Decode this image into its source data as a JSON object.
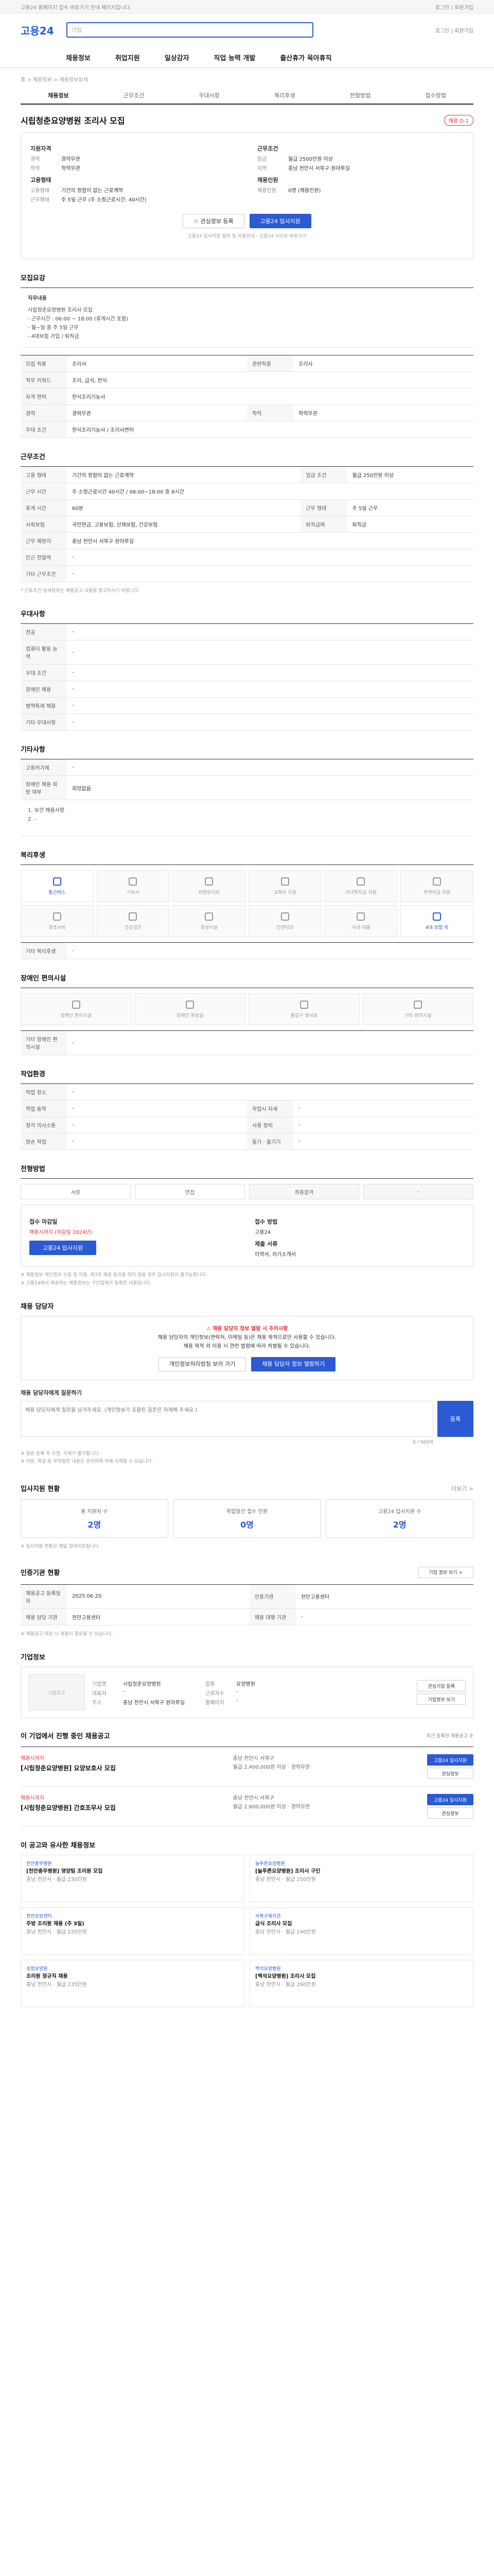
{
  "topbar": {
    "left": "고용24 홈페이지 접속 바로가기 안내 페이지입니다.",
    "right": "로그인 | 회원가입"
  },
  "header": {
    "logo": "고용24",
    "search_placeholder": "기업",
    "right": "로그인 | 회원가입"
  },
  "gnb": [
    "채용정보",
    "취업지원",
    "일상감자",
    "직업 능력 개발",
    "출산휴가 육아휴직"
  ],
  "breadcrumb": "홈 > 채용정보 > 채용정보상세",
  "subtabs": [
    "채용정보",
    "근무조건",
    "우대사항",
    "복리후생",
    "전형방법",
    "접수방법"
  ],
  "posting": {
    "title": "시립청춘요양병원 조리사 모집",
    "badge": "채용 D-1",
    "summary_left_label": "지원자격",
    "summary_left": [
      {
        "k": "경력",
        "v": "경력무관"
      },
      {
        "k": "학력",
        "v": "학력무관"
      }
    ],
    "summary_left_label2": "고용형태",
    "summary_left2": [
      {
        "k": "고용형태",
        "v": "기간의 정함이 없는 근로계약"
      },
      {
        "k": "근무형태",
        "v": "주 5일 근무 (주 소정근로시간: 40시간)"
      }
    ],
    "summary_right_label": "근무조건",
    "summary_right": [
      {
        "k": "임금",
        "v": "월급 2500만원 이상"
      },
      {
        "k": "지역",
        "v": "충남 천안시 서북구 원마루길"
      }
    ],
    "summary_right_label2": "채용인원",
    "summary_right2": [
      {
        "k": "채용인원",
        "v": "0명 (채용인원)"
      }
    ],
    "scrap_label": "관심정보 등록",
    "apply_label": "고용24 입사지원",
    "note": "고용24 입사지원 절차 및 이용안내 - 고용24 사이트 바로가기"
  },
  "recruit": {
    "title": "모집요강",
    "desc_title": "직무내용",
    "desc_lines": [
      "시립청춘요양병원 조리사 모집",
      "- 근무시간 : 06:00 ~ 18:00 (휴게시간 포함)",
      "- 월~일 중 주 5일 근무",
      "- 4대보험 가입 / 퇴직금"
    ],
    "rows": [
      {
        "k": "모집 직종",
        "v": "조리사",
        "k2": "관련직종",
        "v2": "조리사"
      },
      {
        "k": "직무 키워드",
        "v": "조리, 급식, 한식"
      },
      {
        "k": "자격 면허",
        "v": "한식조리기능사"
      },
      {
        "k": "경력",
        "v": "경력무관",
        "k2": "학력",
        "v2": "학력무관"
      },
      {
        "k": "우대 조건",
        "v": "한식조리기능사 / 조리사면허"
      }
    ]
  },
  "work": {
    "title": "근무조건",
    "rows": [
      {
        "k": "고용 형태",
        "v": "기간의 정함이 없는 근로계약",
        "k2": "임금 조건",
        "v2": "월급 250만원 이상"
      },
      {
        "k": "근무 시간",
        "v": "주 소정근로시간 40시간 / 06:00~18:00 중 8시간"
      },
      {
        "k": "휴게 시간",
        "v": "60분",
        "k2": "근무 형태",
        "v2": "주 5일 근무"
      },
      {
        "k": "사회보험",
        "v": "국민연금, 고용보험, 산재보험, 건강보험",
        "k2": "퇴직급여",
        "v2": "퇴직금"
      },
      {
        "k": "근무 예정지",
        "v": "충남 천안시 서북구 원마루길"
      },
      {
        "k": "인근 전철역",
        "v": "-"
      },
      {
        "k": "기타 근무조건",
        "v": "-"
      }
    ],
    "note": "* 근로조건 상세정보는 채용공고 내용을 참고하시기 바랍니다."
  },
  "prefer": {
    "title": "우대사항",
    "rows": [
      {
        "k": "전공",
        "v": "-"
      },
      {
        "k": "컴퓨터 활용 능력",
        "v": "-"
      },
      {
        "k": "우대 조건",
        "v": "-"
      },
      {
        "k": "장애인 채용",
        "v": "-"
      },
      {
        "k": "병역특례 채용",
        "v": "-"
      },
      {
        "k": "기타 우대사항",
        "v": "-"
      }
    ]
  },
  "other": {
    "title": "기타사항",
    "rows": [
      {
        "k": "고용허가제",
        "v": "-"
      },
      {
        "k": "장애인 채용 희망 여부",
        "v": "희망없음"
      }
    ],
    "desc": "1. 보건 채용사항\n2. -"
  },
  "welfare": {
    "title": "복리후생",
    "items": [
      "통근버스",
      "기숙사",
      "차량유지비",
      "교육비 지원",
      "자녀학자금 지원",
      "주택자금 지원",
      "경조사비",
      "건강검진",
      "휴양시설",
      "인센티브",
      "사내 대출",
      "4대 보험 외"
    ],
    "etc_label": "기타 복리후생",
    "etc_value": "-"
  },
  "disabled": {
    "title": "장애인 편의시설",
    "items": [
      "장애인 편의시설",
      "장애인 화장실",
      "출입구 경사로",
      "기타 편의시설"
    ],
    "etc_label": "기타 장애인 편의시설",
    "etc_value": "-"
  },
  "worksite": {
    "title": "작업환경",
    "rows": [
      {
        "k": "작업 장소",
        "v": "-"
      },
      {
        "k": "작업 동작",
        "v": "-",
        "k2": "작업시 자세",
        "v2": "-"
      },
      {
        "k": "청각 의사소통",
        "v": "-",
        "k2": "사용 장비",
        "v2": "-"
      },
      {
        "k": "양손 작업",
        "v": "-",
        "k2": "들기 · 옮기기",
        "v2": "-"
      }
    ]
  },
  "process": {
    "title": "전형방법",
    "steps": [
      "서류",
      "면접",
      "최종합격",
      "-"
    ],
    "apply_title": "접수방법",
    "deadline_label": "접수 마감일",
    "deadline": "채용시까지 (마감일 2024년)",
    "method_label": "접수 방법",
    "method": "고용24",
    "apply_btn": "고용24 입사지원",
    "docs_label": "제출 서류",
    "docs": "이력서, 자기소개서",
    "cautions": [
      "※ 채용정보 개인정보 수집 및 이용, 제3자 제공 동의를 하지 않을 경우 입사지원이 불가능합니다.",
      "※ 고용24에서 제공하는 채용정보는 구인업체가 등록한 내용입니다."
    ]
  },
  "contact": {
    "title": "채용 담당자",
    "notice": "채용 담당자 정보 열람 시 주의사항",
    "desc": "채용 담당자의 개인정보(연락처, 이메일 등)은 채용 목적으로만 사용할 수 있습니다.",
    "desc2": "채용 목적 외 이용 시 관련 법령에 따라 처벌될 수 있습니다.",
    "agree_btn": "개인정보처리방침 보러 가기",
    "view_btn": "채용 담당자 정보 열람하기"
  },
  "qna": {
    "title": "채용 담당자에게 질문하기",
    "placeholder": "채용 담당자에게 질문을 남겨주세요. (개인정보가 포함된 질문은 자제해 주세요.)",
    "count": "0 / 500자",
    "submit": "등록",
    "notes": [
      "※ 질문 등록 후 수정, 삭제가 불가합니다.",
      "※ 비방, 욕설 등 부적절한 내용은 관리자에 의해 삭제될 수 있습니다."
    ]
  },
  "applicants": {
    "title": "입사지원 현황",
    "link": "더보기 >",
    "items": [
      {
        "label": "총 지원자 수",
        "value": "2명"
      },
      {
        "label": "취업알선 접수 인원",
        "value": "0명"
      },
      {
        "label": "고용24 입사지원 수",
        "value": "2명"
      }
    ],
    "note": "※ 입사지원 현황은 매일 업데이트됩니다."
  },
  "stats": {
    "title": "인증기관 현황",
    "link": "기업 정보 보기 >",
    "rows": [
      {
        "k": "채용공고 등록일자",
        "v": "2025.06.20",
        "k2": "인증기관",
        "v2": "천안고용센터"
      },
      {
        "k": "채용 담당 기관",
        "v": "천안고용센터",
        "k2": "채용 대행 기관",
        "v2": "-"
      }
    ],
    "note": "※ 채용공고 마감 시 채용이 종료될 수 있습니다."
  },
  "company": {
    "title": "기업정보",
    "logo_alt": "기업로고",
    "name": "시립청춘요양병원",
    "rows": [
      {
        "k": "기업명",
        "v": "시립청춘요양병원",
        "k2": "업종",
        "v2": "요양병원"
      },
      {
        "k": "대표자",
        "v": "-",
        "k2": "근로자수",
        "v2": "-"
      },
      {
        "k": "주소",
        "v": "충남 천안시 서북구 원마루길",
        "k2": "홈페이지",
        "v2": "-"
      }
    ],
    "btn1": "관심기업 등록",
    "btn2": "기업정보 보기"
  },
  "related": {
    "title": "이 기업에서 진행 중인 채용공고",
    "note": "최근 등록된 채용공고 순",
    "items": [
      {
        "deadline": "채용시까지",
        "title": "[시립청춘요양병원] 요양보호사 모집",
        "loc": "충남 천안시 서북구",
        "cond": "월급 2,400,000원 이상 · 경력무관",
        "apply": "고용24 입사지원",
        "scrap": "관심정보"
      },
      {
        "deadline": "채용시까지",
        "title": "[시립청춘요양병원] 간호조무사 모집",
        "loc": "충남 천안시 서북구",
        "cond": "월급 2,600,000원 이상 · 경력무관",
        "apply": "고용24 입사지원",
        "scrap": "관심정보"
      }
    ]
  },
  "recommend": {
    "title": "이 공고와 유사한 채용정보",
    "items": [
      {
        "co": "천안충무병원",
        "title": "[천안충무병원] 영양팀 조리원 모집",
        "info": "충남 천안시 · 월급 230만원"
      },
      {
        "co": "늘푸른요양병원",
        "title": "[늘푸른요양병원] 조리사 구인",
        "info": "충남 천안시 · 월급 250만원"
      },
      {
        "co": "천안요양센터",
        "title": "주방 조리원 채용 (주 5일)",
        "info": "충남 천안시 · 월급 220만원"
      },
      {
        "co": "서북구복지관",
        "title": "급식 조리사 모집",
        "info": "충남 천안시 · 월급 240만원"
      },
      {
        "co": "성정요양원",
        "title": "조리원 정규직 채용",
        "info": "충남 천안시 · 월급 235만원"
      },
      {
        "co": "백석요양병원",
        "title": "[백석요양병원] 조리사 모집",
        "info": "충남 천안시 · 월급 260만원"
      }
    ]
  },
  "colors": {
    "accent": "#2c5ad3",
    "danger": "#d33333"
  }
}
